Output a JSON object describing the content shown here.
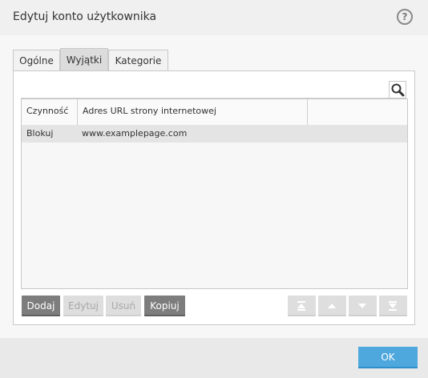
{
  "window": {
    "title": "Edytuj konto użytkownika",
    "help_label": "?"
  },
  "tabs": [
    {
      "label": "Ogólne",
      "active": false
    },
    {
      "label": "Wyjątki",
      "active": true
    },
    {
      "label": "Kategorie",
      "active": false
    }
  ],
  "search": {
    "icon": "search-icon"
  },
  "table": {
    "columns": [
      "Czynność",
      "Adres URL strony internetowej"
    ],
    "rows": [
      {
        "action": "Blokuj",
        "url": "www.examplepage.com",
        "selected": true
      }
    ]
  },
  "toolbar": {
    "add_label": "Dodaj",
    "edit_label": "Edytuj",
    "remove_label": "Usuń",
    "copy_label": "Kopiuj",
    "move_buttons": [
      "move-top-icon",
      "move-up-icon",
      "move-down-icon",
      "move-bottom-icon"
    ]
  },
  "footer": {
    "ok_label": "OK"
  },
  "colors": {
    "accent": "#4ea8dd",
    "dark_button": "#7d7d7d",
    "disabled_button": "#dedede"
  }
}
